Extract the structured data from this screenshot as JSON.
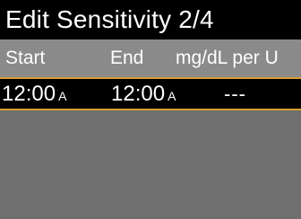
{
  "title": "Edit Sensitivity 2/4",
  "columns": {
    "start": "Start",
    "end": "End",
    "rate": "mg/dL per U"
  },
  "rows": [
    {
      "start_time": "12:00",
      "start_ampm": "A",
      "end_time": "12:00",
      "end_ampm": "A",
      "value": "---"
    }
  ],
  "colors": {
    "titlebar": "#000000",
    "header": "#8a8a8a",
    "background": "#6f6f6f",
    "selection_border": "#d79e2d",
    "text": "#ffffff"
  }
}
